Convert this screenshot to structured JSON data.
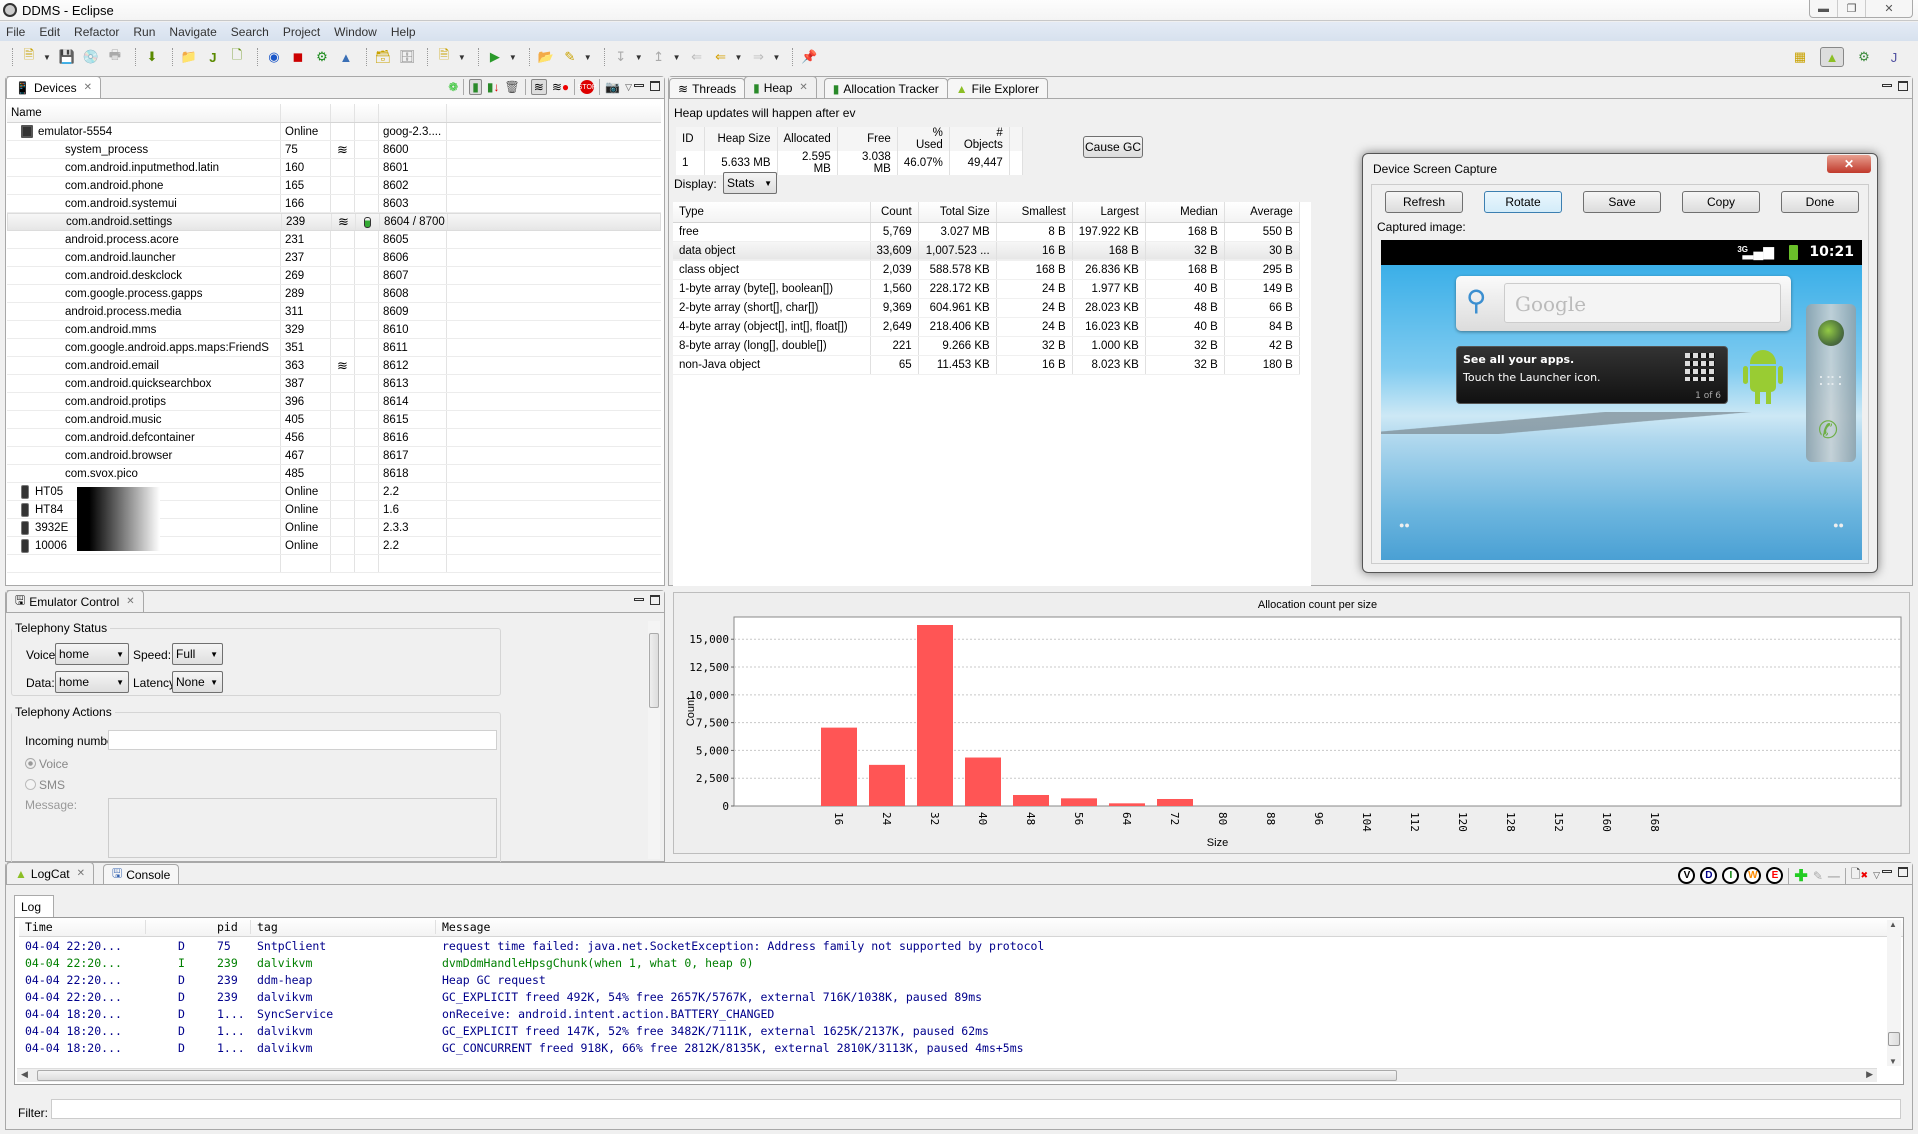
{
  "window": {
    "title": "DDMS - Eclipse",
    "controls": [
      "minimize",
      "restore",
      "close"
    ]
  },
  "menu": [
    "File",
    "Edit",
    "Refactor",
    "Run",
    "Navigate",
    "Search",
    "Project",
    "Window",
    "Help"
  ],
  "perspectives": [
    "open-perspective-icon",
    "ddms-android-icon",
    "debug-icon",
    "java-icon"
  ],
  "devices": {
    "tab_label": "Devices",
    "header": {
      "name": "Name"
    },
    "toolbar_icons": [
      "debug-process-icon",
      "update-heap-icon",
      "dump-hprof-icon",
      "cause-gc-icon",
      "update-threads-icon",
      "start-method-profiling-icon",
      "stop-process-icon",
      "screen-capture-icon"
    ],
    "rows": [
      {
        "name": "emulator-5554",
        "col2": "Online",
        "col5": "goog-2.3....",
        "type": "emulator"
      },
      {
        "name": "system_process",
        "col2": "75",
        "col5": "8600",
        "threads": true
      },
      {
        "name": "com.android.inputmethod.latin",
        "col2": "160",
        "col5": "8601"
      },
      {
        "name": "com.android.phone",
        "col2": "165",
        "col5": "8602"
      },
      {
        "name": "com.android.systemui",
        "col2": "166",
        "col5": "8603"
      },
      {
        "name": "com.android.settings",
        "col2": "239",
        "col5": "8604 / 8700",
        "threads": true,
        "heap": true,
        "selected": true
      },
      {
        "name": "android.process.acore",
        "col2": "231",
        "col5": "8605"
      },
      {
        "name": "com.android.launcher",
        "col2": "237",
        "col5": "8606"
      },
      {
        "name": "com.android.deskclock",
        "col2": "269",
        "col5": "8607"
      },
      {
        "name": "com.google.process.gapps",
        "col2": "289",
        "col5": "8608"
      },
      {
        "name": "android.process.media",
        "col2": "311",
        "col5": "8609"
      },
      {
        "name": "com.android.mms",
        "col2": "329",
        "col5": "8610"
      },
      {
        "name": "com.google.android.apps.maps:FriendS",
        "col2": "351",
        "col5": "8611"
      },
      {
        "name": "com.android.email",
        "col2": "363",
        "col5": "8612",
        "threads": true
      },
      {
        "name": "com.android.quicksearchbox",
        "col2": "387",
        "col5": "8613"
      },
      {
        "name": "com.android.protips",
        "col2": "396",
        "col5": "8614"
      },
      {
        "name": "com.android.music",
        "col2": "405",
        "col5": "8615"
      },
      {
        "name": "com.android.defcontainer",
        "col2": "456",
        "col5": "8616"
      },
      {
        "name": "com.android.browser",
        "col2": "467",
        "col5": "8617"
      },
      {
        "name": "com.svox.pico",
        "col2": "485",
        "col5": "8618"
      },
      {
        "name": "HT05",
        "col2": "Online",
        "col5": "2.2",
        "type": "device"
      },
      {
        "name": "HT84",
        "col2": "Online",
        "col5": "1.6",
        "type": "device"
      },
      {
        "name": "3932E",
        "col2": "Online",
        "col5": "2.3.3",
        "type": "device"
      },
      {
        "name": "10006",
        "col2": "Online",
        "col5": "2.2",
        "type": "device"
      }
    ]
  },
  "emulator_control": {
    "tab_label": "Emulator Control",
    "telephony_status": {
      "legend": "Telephony Status",
      "voice_label": "Voice:",
      "voice_value": "home",
      "speed_label": "Speed:",
      "speed_value": "Full",
      "data_label": "Data:",
      "data_value": "home",
      "latency_label": "Latency:",
      "latency_value": "None"
    },
    "telephony_actions": {
      "legend": "Telephony Actions",
      "incoming_label": "Incoming number:",
      "incoming_value": "",
      "voice_radio": "Voice",
      "sms_radio": "SMS",
      "message_label": "Message:"
    }
  },
  "heap": {
    "tabs": [
      {
        "label": "Threads"
      },
      {
        "label": "Heap",
        "active": true
      },
      {
        "label": "Allocation Tracker"
      },
      {
        "label": "File Explorer"
      }
    ],
    "notice": "Heap updates will happen after ev",
    "stats_headers": [
      "ID",
      "Heap Size",
      "Allocated",
      "Free",
      "% Used",
      "# Objects"
    ],
    "stats_row": [
      "1",
      "5.633 MB",
      "2.595 MB",
      "3.038 MB",
      "46.07%",
      "49,447"
    ],
    "cause_gc_label": "Cause GC",
    "display_label": "Display:",
    "display_value": "Stats",
    "type_headers": [
      "Type",
      "Count",
      "Total Size",
      "Smallest",
      "Largest",
      "Median",
      "Average"
    ],
    "type_rows": [
      [
        "free",
        "5,769",
        "3.027 MB",
        "8 B",
        "197.922 KB",
        "168 B",
        "550 B"
      ],
      [
        "data object",
        "33,609",
        "1,007.523 ...",
        "16 B",
        "168 B",
        "32 B",
        "30 B"
      ],
      [
        "class object",
        "2,039",
        "588.578 KB",
        "168 B",
        "26.836 KB",
        "168 B",
        "295 B"
      ],
      [
        "1-byte array (byte[], boolean[])",
        "1,560",
        "228.172 KB",
        "24 B",
        "1.977 KB",
        "40 B",
        "149 B"
      ],
      [
        "2-byte array (short[], char[])",
        "9,369",
        "604.961 KB",
        "24 B",
        "28.023 KB",
        "48 B",
        "66 B"
      ],
      [
        "4-byte array (object[], int[], float[])",
        "2,649",
        "218.406 KB",
        "24 B",
        "16.023 KB",
        "40 B",
        "84 B"
      ],
      [
        "8-byte array (long[], double[])",
        "221",
        "9.266 KB",
        "32 B",
        "1.000 KB",
        "32 B",
        "42 B"
      ],
      [
        "non-Java object",
        "65",
        "11.453 KB",
        "16 B",
        "8.023 KB",
        "32 B",
        "180 B"
      ]
    ],
    "selected_row": 1
  },
  "chart_data": {
    "type": "bar",
    "title": "Allocation count per size",
    "xlabel": "Size",
    "ylabel": "Count",
    "categories": [
      "16",
      "24",
      "32",
      "40",
      "48",
      "56",
      "64",
      "72",
      "80",
      "88",
      "96",
      "104",
      "112",
      "120",
      "128",
      "152",
      "160",
      "168"
    ],
    "values": [
      7050,
      3700,
      16280,
      4360,
      990,
      690,
      240,
      630,
      0,
      0,
      0,
      0,
      0,
      0,
      0,
      0,
      0,
      0
    ],
    "yticks": [
      0,
      2500,
      5000,
      7500,
      10000,
      12500,
      15000
    ],
    "ytick_labels": [
      "0",
      "2,500",
      "5,000",
      "7,500",
      "10,000",
      "12,500",
      "15,000"
    ],
    "ylim": [
      0,
      17000
    ],
    "grid": true,
    "bar_color": "#ff5555"
  },
  "dialog": {
    "title": "Device Screen Capture",
    "buttons": [
      "Refresh",
      "Rotate",
      "Save",
      "Copy",
      "Done"
    ],
    "captured_label": "Captured image:",
    "screen": {
      "time": "10:21",
      "search_placeholder": "Google",
      "tip_title": "See all your apps.",
      "tip_body": "Touch the Launcher icon.",
      "tip_counter": "1 of 6"
    }
  },
  "logcat": {
    "tabs": [
      "LogCat",
      "Console"
    ],
    "subtab": "Log",
    "level_buttons": [
      "V",
      "D",
      "I",
      "W",
      "E"
    ],
    "level_colors": [
      "#000000",
      "#00008b",
      "#007f00",
      "#ff8c00",
      "#ff0000"
    ],
    "headers": [
      "Time",
      "",
      "pid",
      "tag",
      "Message"
    ],
    "rows": [
      {
        "time": "04-04 22:20...",
        "level": "D",
        "pid": "75",
        "tag": "SntpClient",
        "msg": "request time failed: java.net.SocketException: Address family not supported by protocol"
      },
      {
        "time": "04-04 22:20...",
        "level": "I",
        "pid": "239",
        "tag": "dalvikvm",
        "msg": "dvmDdmHandleHpsgChunk(when 1, what 0, heap 0)"
      },
      {
        "time": "04-04 22:20...",
        "level": "D",
        "pid": "239",
        "tag": "ddm-heap",
        "msg": "Heap GC request"
      },
      {
        "time": "04-04 22:20...",
        "level": "D",
        "pid": "239",
        "tag": "dalvikvm",
        "msg": "GC_EXPLICIT freed 492K, 54% free 2657K/5767K, external 716K/1038K, paused 89ms"
      },
      {
        "time": "04-04 18:20...",
        "level": "D",
        "pid": "1...",
        "tag": "SyncService",
        "msg": "onReceive: android.intent.action.BATTERY_CHANGED"
      },
      {
        "time": "04-04 18:20...",
        "level": "D",
        "pid": "1...",
        "tag": "dalvikvm",
        "msg": "GC_EXPLICIT freed 147K, 52% free 3482K/7111K, external 1625K/2137K, paused 62ms"
      },
      {
        "time": "04-04 18:20...",
        "level": "D",
        "pid": "1...",
        "tag": "dalvikvm",
        "msg": "GC_CONCURRENT freed 918K, 66% free 2812K/8135K, external 2810K/3113K, paused 4ms+5ms"
      }
    ],
    "filter_label": "Filter:",
    "filter_value": ""
  }
}
